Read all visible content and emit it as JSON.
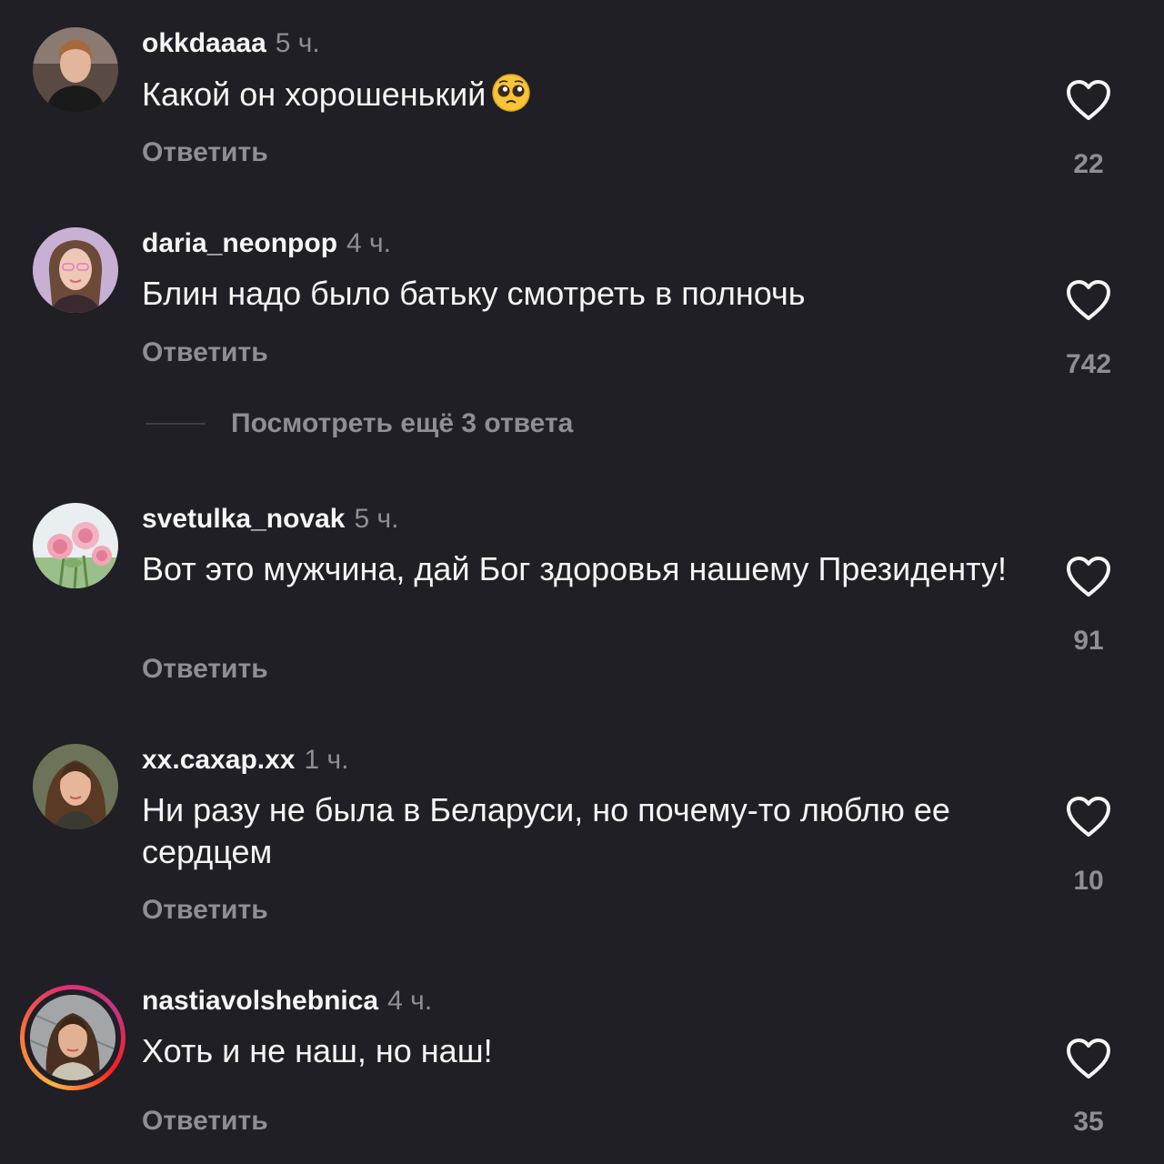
{
  "comments": [
    {
      "username": "okkdaaaa",
      "time": "5 ч.",
      "text": "Какой он хорошенький",
      "emoji": "pleading-face-emoji",
      "reply_label": "Ответить",
      "likes": "22",
      "avatar": "woman-dark-top-avatar"
    },
    {
      "username": "daria_neonpop",
      "time": "4 ч.",
      "text": "Блин надо было батьку смотреть в полночь",
      "reply_label": "Ответить",
      "likes": "742",
      "avatar": "woman-pink-light-avatar"
    },
    {
      "username": "svetulka_novak",
      "time": "5 ч.",
      "text": "Вот это мужчина, дай Бог здоровья нашему Президенту!",
      "reply_label": "Ответить",
      "likes": "91",
      "avatar": "pink-roses-avatar"
    },
    {
      "username": "xx.caxap.xx",
      "time": "1 ч.",
      "text": "Ни разу не была в Беларуси, но почему-то люблю ее сердцем",
      "reply_label": "Ответить",
      "likes": "10",
      "avatar": "woman-long-hair-avatar"
    },
    {
      "username": "nastiavolshebnica",
      "time": "4 ч.",
      "text": "Хоть и не наш, но наш!",
      "reply_label": "Ответить",
      "likes": "35",
      "avatar": "woman-story-ring-avatar",
      "has_story": true
    }
  ],
  "more_replies": {
    "label": "Посмотреть ещё 3 ответа"
  },
  "colors": {
    "background": "#1f1f25",
    "text": "#f5f5f5",
    "secondary": "#8e8e93",
    "story_ring": [
      "#fcaf45",
      "#e1306c",
      "#c13584"
    ]
  },
  "icons": [
    "heart-outline-icon",
    "pleading-face-emoji"
  ]
}
